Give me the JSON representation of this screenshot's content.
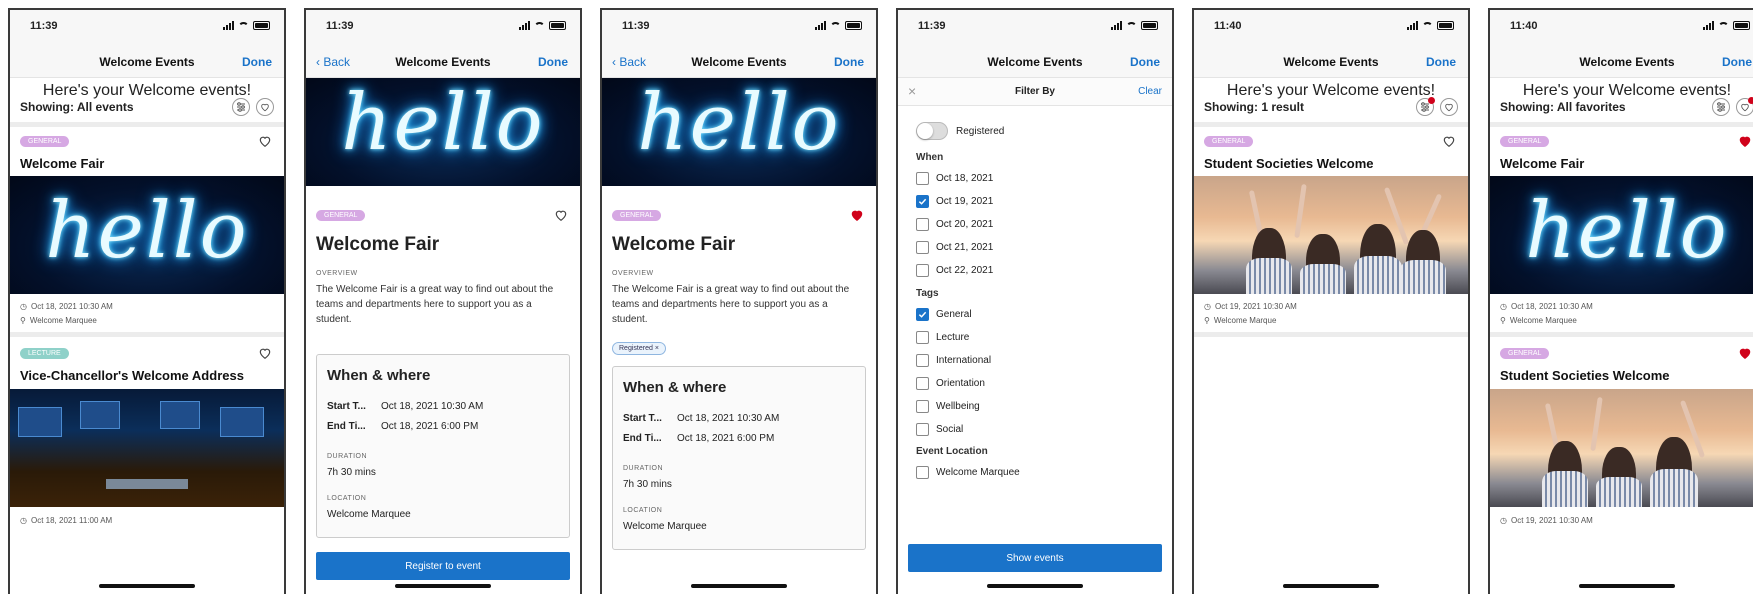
{
  "colors": {
    "accent": "#1a73c9",
    "heart_active": "#d0021b",
    "tag_general": "#d6a8e3",
    "tag_lecture": "#8fd1c9"
  },
  "screen1": {
    "time": "11:39",
    "title": "Welcome Events",
    "done": "Done",
    "headline": "Here's your Welcome events!",
    "showing": "Showing: All events",
    "events": [
      {
        "tag": "GENERAL",
        "name": "Welcome Fair",
        "image_text": "hello",
        "date": "Oct 18, 2021 10:30 AM",
        "location": "Welcome Marquee"
      },
      {
        "tag": "LECTURE",
        "name": "Vice-Chancellor's Welcome Address",
        "date": "Oct 18, 2021 11:00 AM"
      }
    ]
  },
  "screen2": {
    "time": "11:39",
    "back": "Back",
    "title": "Welcome Events",
    "done": "Done",
    "image_text": "hello",
    "tag": "GENERAL",
    "event_name": "Welcome Fair",
    "overview_label": "OVERVIEW",
    "overview": "The Welcome Fair is a great way to find out about the teams and departments here to support you as a student.",
    "when_where": "When & where",
    "start_label": "Start T...",
    "start_value": "Oct 18, 2021 10:30 AM",
    "end_label": "End Ti...",
    "end_value": "Oct 18, 2021 6:00 PM",
    "duration_label": "DURATION",
    "duration": "7h 30 mins",
    "location_label": "LOCATION",
    "location": "Welcome Marquee",
    "register": "Register to event"
  },
  "screen3": {
    "time": "11:39",
    "back": "Back",
    "title": "Welcome Events",
    "done": "Done",
    "image_text": "hello",
    "tag": "GENERAL",
    "event_name": "Welcome Fair",
    "overview_label": "OVERVIEW",
    "overview": "The Welcome Fair is a great way to find out about the teams and departments here to support you as a student.",
    "registered_chip": "Registered",
    "chip_x": "×",
    "when_where": "When & where",
    "start_label": "Start T...",
    "start_value": "Oct 18, 2021 10:30 AM",
    "end_label": "End Ti...",
    "end_value": "Oct 18, 2021 6:00 PM",
    "duration_label": "DURATION",
    "duration": "7h 30 mins",
    "location_label": "LOCATION",
    "location": "Welcome Marquee"
  },
  "screen4": {
    "time": "11:39",
    "title": "Welcome Events",
    "done": "Done",
    "close": "×",
    "filter_title": "Filter By",
    "clear": "Clear",
    "registered": "Registered",
    "when": "When",
    "dates": [
      {
        "label": "Oct 18, 2021",
        "checked": false
      },
      {
        "label": "Oct 19, 2021",
        "checked": true
      },
      {
        "label": "Oct 20, 2021",
        "checked": false
      },
      {
        "label": "Oct 21, 2021",
        "checked": false
      },
      {
        "label": "Oct 22, 2021",
        "checked": false
      }
    ],
    "tags_label": "Tags",
    "tags": [
      {
        "label": "General",
        "checked": true
      },
      {
        "label": "Lecture",
        "checked": false
      },
      {
        "label": "International",
        "checked": false
      },
      {
        "label": "Orientation",
        "checked": false
      },
      {
        "label": "Wellbeing",
        "checked": false
      },
      {
        "label": "Social",
        "checked": false
      }
    ],
    "location_label": "Event Location",
    "locations": [
      {
        "label": "Welcome Marquee",
        "checked": false
      }
    ],
    "show": "Show events"
  },
  "screen5": {
    "time": "11:40",
    "title": "Welcome Events",
    "done": "Done",
    "headline": "Here's your Welcome events!",
    "showing": "Showing: 1 result",
    "event": {
      "tag": "GENERAL",
      "name": "Student Societies Welcome",
      "date": "Oct 19, 2021 10:30 AM",
      "location": "Welcome Marque"
    }
  },
  "screen6": {
    "time": "11:40",
    "title": "Welcome Events",
    "done": "Done",
    "headline": "Here's your Welcome events!",
    "showing": "Showing: All favorites",
    "events": [
      {
        "tag": "GENERAL",
        "name": "Welcome Fair",
        "image_text": "hello",
        "date": "Oct 18, 2021 10:30 AM",
        "location": "Welcome Marquee"
      },
      {
        "tag": "GENERAL",
        "name": "Student Societies Welcome",
        "date": "Oct 19, 2021 10:30 AM"
      }
    ]
  }
}
